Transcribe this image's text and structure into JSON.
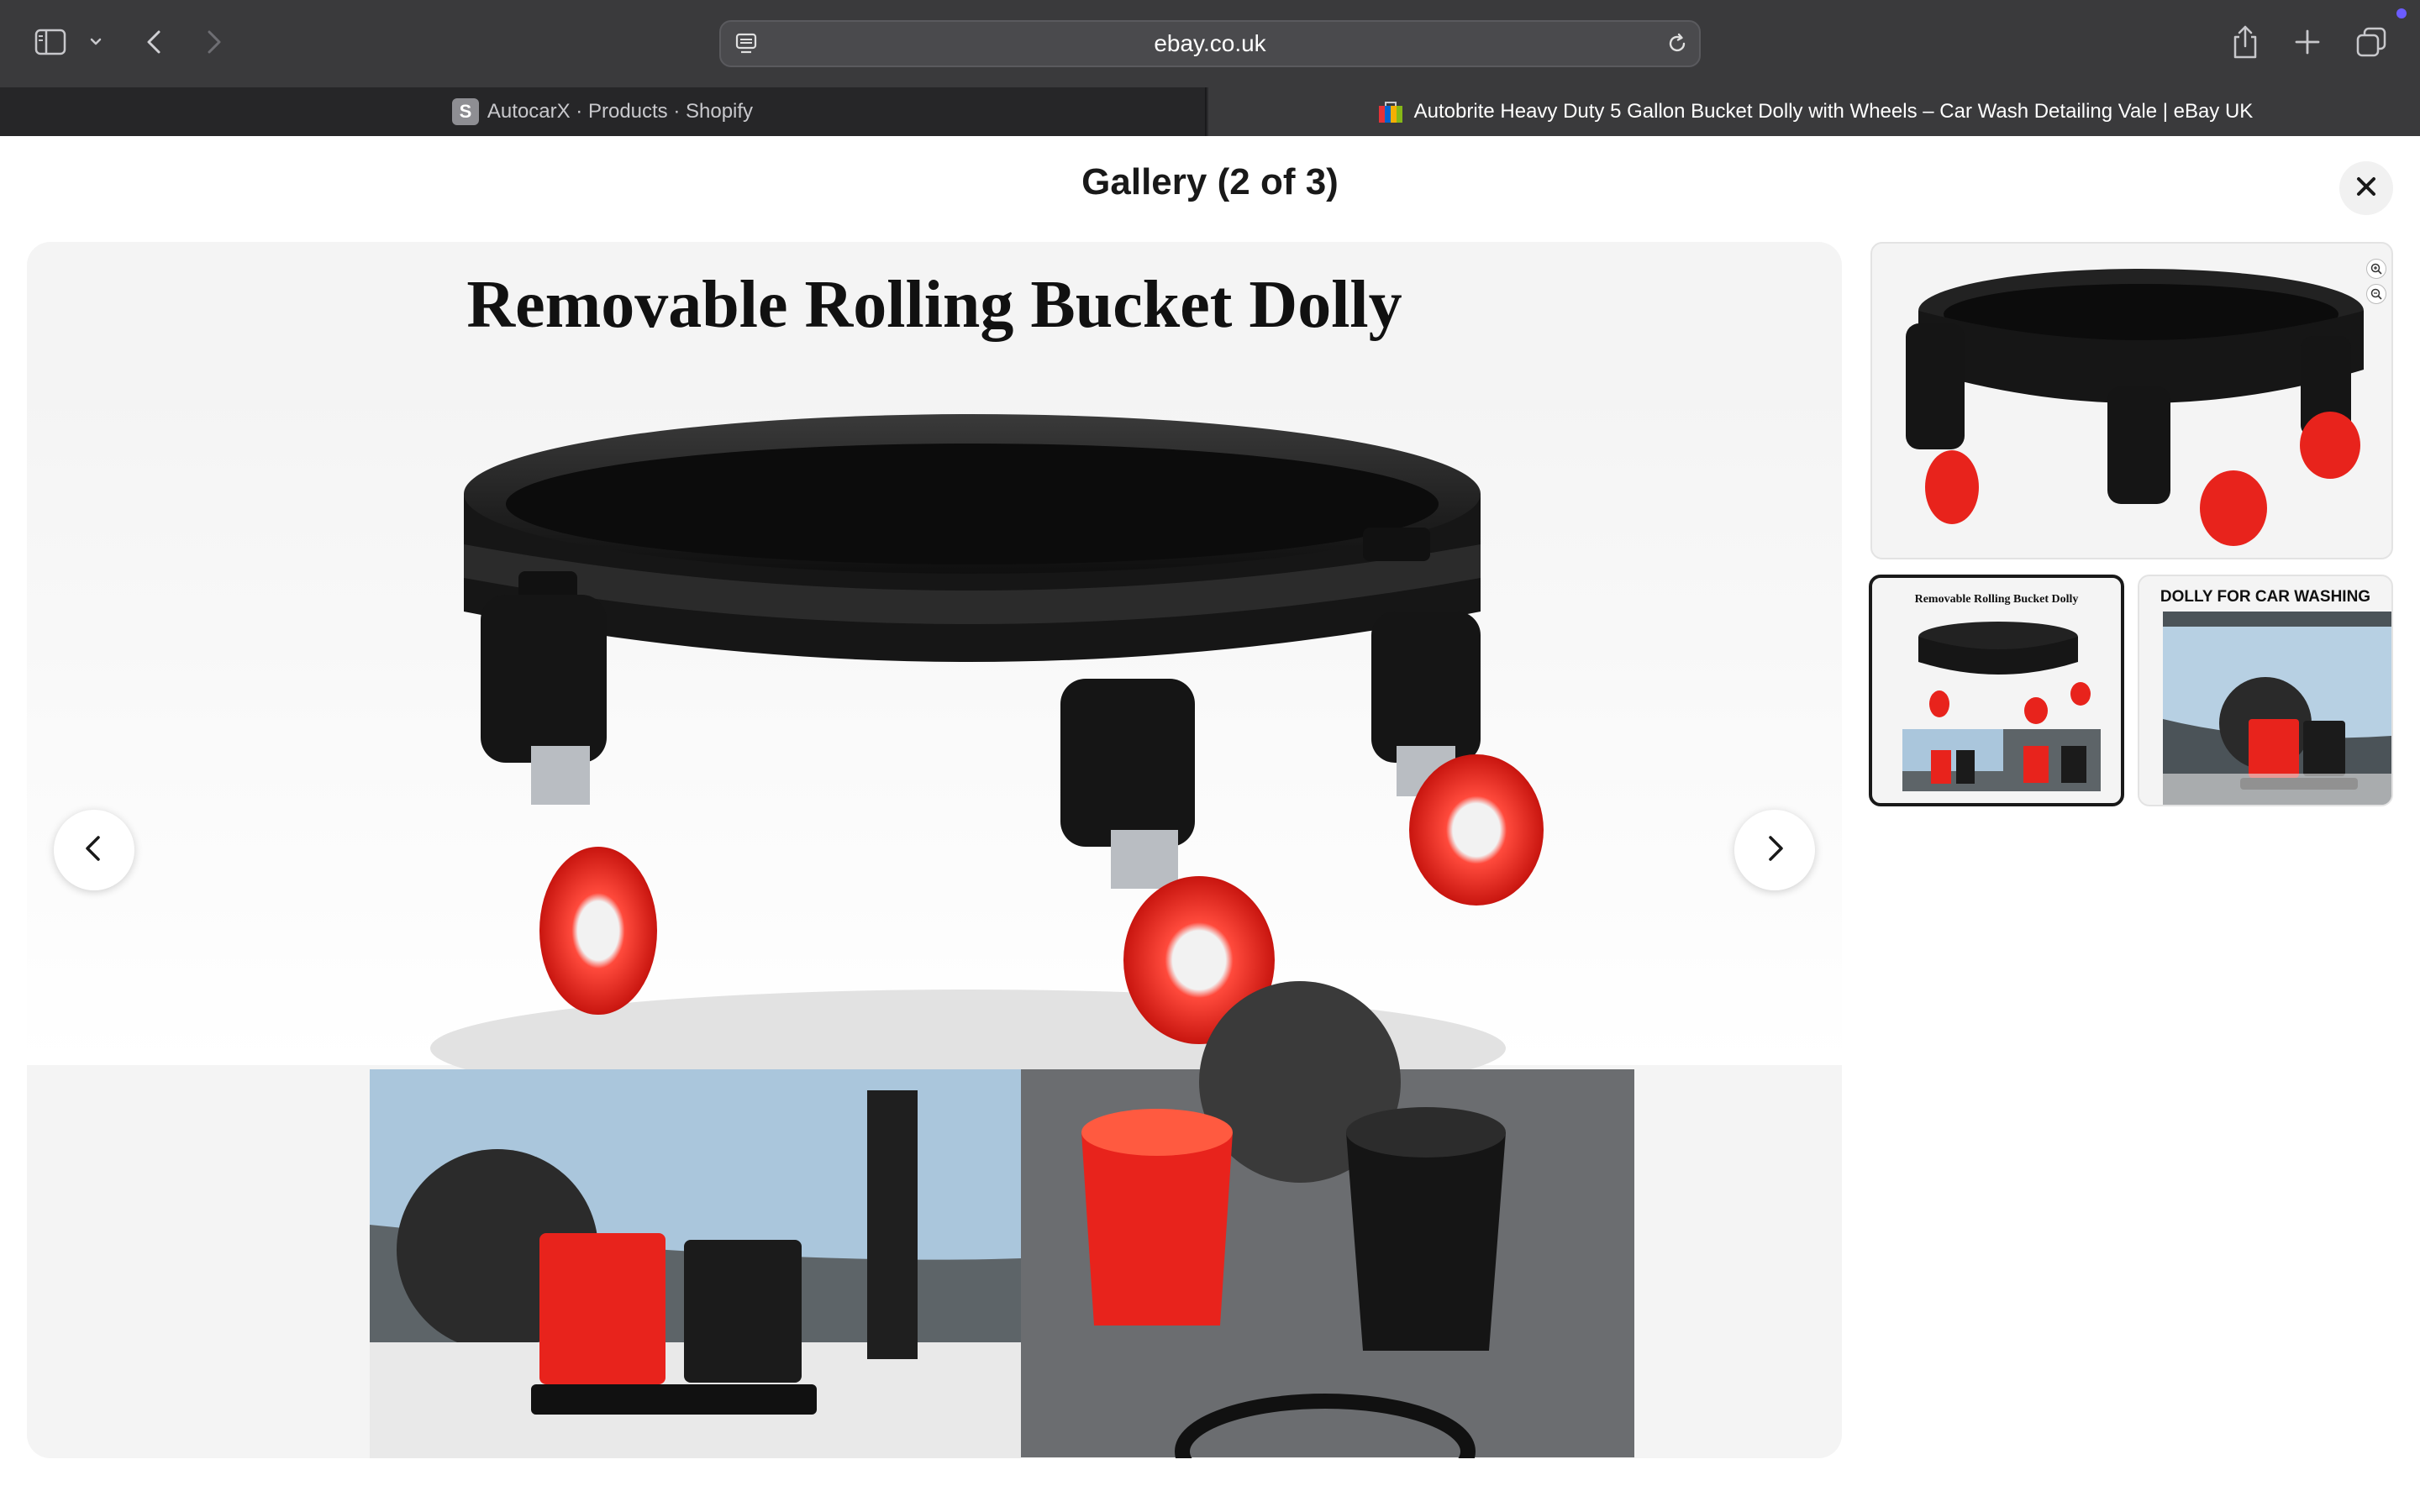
{
  "browser": {
    "url": "ebay.co.uk",
    "tabs": [
      {
        "favicon_letter": "S",
        "title": "AutocarX · Products · Shopify",
        "active": false
      },
      {
        "title": "Autobrite Heavy Duty 5 Gallon Bucket Dolly with Wheels – Car Wash Detailing Vale | eBay UK",
        "active": true
      }
    ],
    "icons": [
      "sidebar-icon",
      "chevron-down-icon",
      "back-icon",
      "forward-icon",
      "site-info-icon",
      "reload-icon",
      "share-icon",
      "new-tab-icon",
      "tab-overview-icon"
    ]
  },
  "gallery": {
    "title": "Gallery (2 of 3)",
    "main_image": {
      "headline": "Removable Rolling Bucket Dolly"
    },
    "thumbnails": [
      {
        "caption": "",
        "selected": false
      },
      {
        "caption": "Removable Rolling Bucket Dolly",
        "selected": true
      },
      {
        "caption": "DOLLY FOR CAR WASHING",
        "selected": false
      }
    ],
    "controls": [
      "close-icon",
      "chevron-left-icon",
      "chevron-right-icon",
      "zoom-in-icon",
      "zoom-out-icon"
    ]
  },
  "colors": {
    "toolbar": "#3a3a3c",
    "tabbar": "#2b2b2d",
    "bucket_red": "#e8231c",
    "dolly_black": "#1c1c1c",
    "selected_border": "#191919"
  }
}
